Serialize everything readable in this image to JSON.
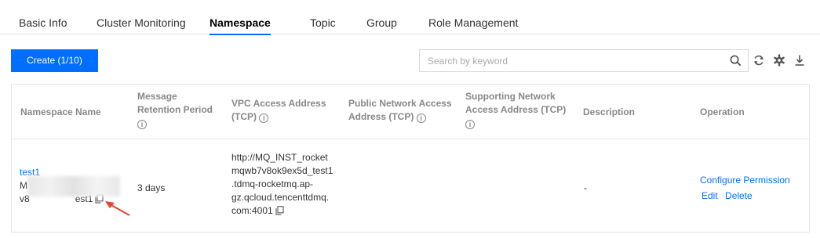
{
  "tabs": [
    {
      "label": "Basic Info"
    },
    {
      "label": "Cluster Monitoring"
    },
    {
      "label": "Namespace"
    },
    {
      "label": "Topic"
    },
    {
      "label": "Group"
    },
    {
      "label": "Role Management"
    }
  ],
  "toolbar": {
    "create_label": "Create (1/10)",
    "search_placeholder": "Search by keyword"
  },
  "table": {
    "headers": {
      "name": "Namespace Name",
      "retention_1": "Message",
      "retention_2": "Retention Period",
      "vpc_1": "VPC Access Address",
      "vpc_2": "(TCP)",
      "public_1": "Public Network Access",
      "public_2": "Address (TCP)",
      "support_1": "Supporting Network",
      "support_2": "Access Address (TCP)",
      "description": "Description",
      "operation": "Operation"
    },
    "rows": [
      {
        "name": "test1",
        "id_line1": "M",
        "id_line2_start": "v8",
        "id_line2_end": "est1",
        "retention": "3 days",
        "vpc_lines": [
          "http://MQ_INST_rocket",
          "mqwb7v8ok9ex5d_test1",
          ".tdmq-rocketmq.ap-",
          "gz.qcloud.tencenttdmq.",
          "com:4001"
        ],
        "description": "-",
        "actions": {
          "configure": "Configure Permission",
          "edit": "Edit",
          "delete": "Delete"
        }
      }
    ]
  },
  "colors": {
    "primary": "#006eff",
    "annotation_arrow": "#e8412c"
  },
  "icons": [
    "search-icon",
    "refresh-icon",
    "settings-icon",
    "download-icon",
    "info-icon",
    "copy-icon"
  ]
}
